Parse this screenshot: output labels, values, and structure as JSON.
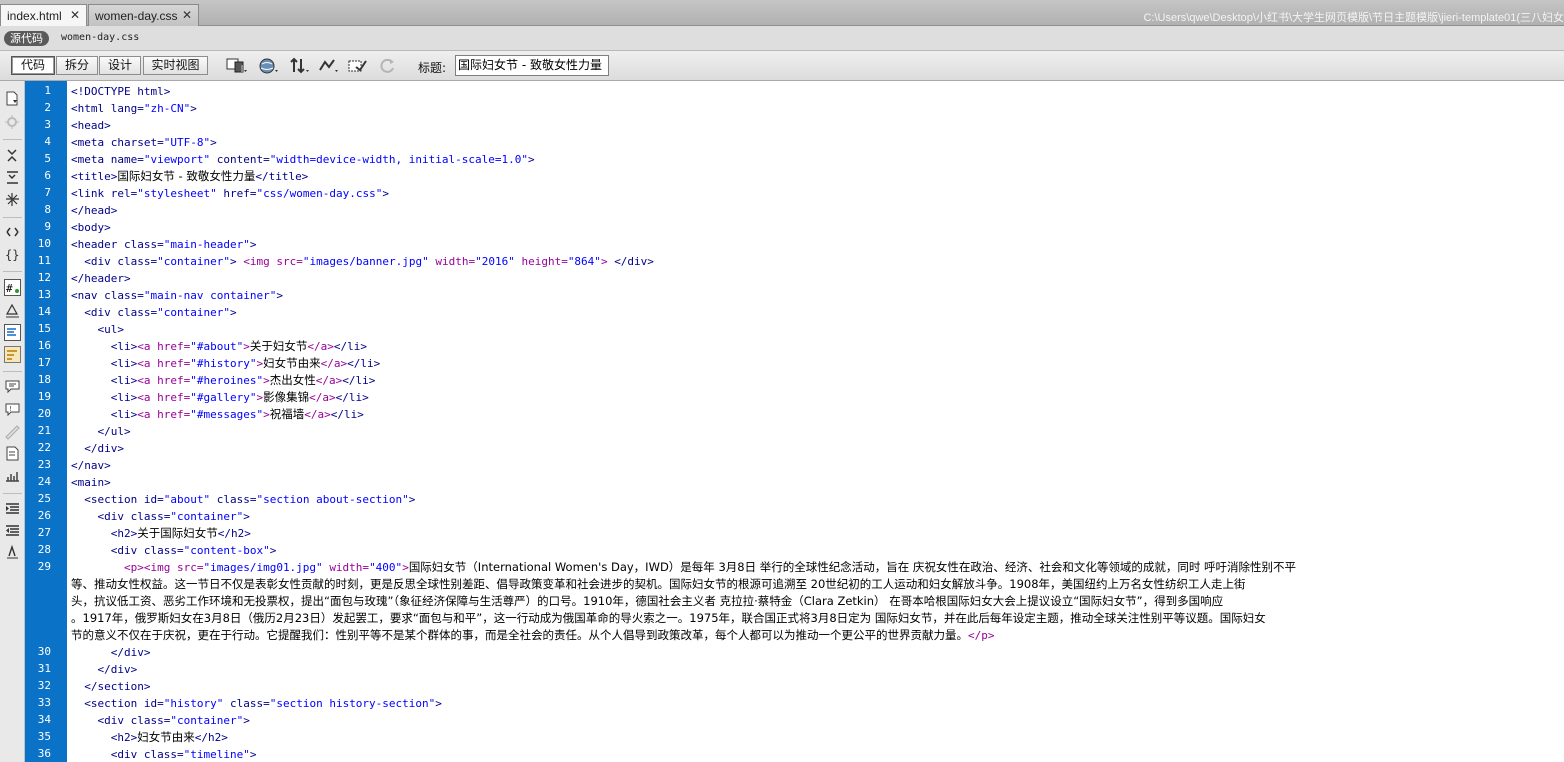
{
  "tabs": [
    {
      "label": "index.html",
      "active": true
    },
    {
      "label": "women-day.css",
      "active": false
    }
  ],
  "close_glyph": "✕",
  "file_path": "C:\\Users\\qwe\\Desktop\\小红书\\大学生网页模版\\节日主题模版\\jieri-template01(三八妇女",
  "related": {
    "source_code": "源代码",
    "file": "women-day.css"
  },
  "view_buttons": [
    "代码",
    "拆分",
    "设计",
    "实时视图"
  ],
  "title_label": "标题:",
  "title_value": "国际妇女节 - 致敬女性力量",
  "colors": {
    "gutter": "#0a72c7",
    "tag": "#000088",
    "value": "#0000ff",
    "inline_tag": "#990099"
  },
  "toolbar_icons": [
    "multiscreen-icon",
    "preview-globe-icon",
    "file-transfer-icon",
    "debug-icon",
    "visual-aids-icon",
    "refresh-icon"
  ],
  "sidebar_icons": [
    "open-documents-icon",
    "show-code-navigator-icon",
    "collapse-full-tag-icon",
    "collapse-selection-icon",
    "expand-all-icon",
    "select-parent-tag-icon",
    "balance-braces-icon",
    "line-numbers-icon",
    "highlight-invalid-code-icon",
    "syntax-coloring-icon",
    "word-wrap-icon",
    "info-bar-icon",
    "apply-comment-icon",
    "remove-comment-icon",
    "wrap-tag-icon",
    "recent-snippets-icon",
    "move-css-icon",
    "indent-code-icon",
    "outdent-code-icon",
    "format-source-icon"
  ],
  "code_lines": [
    {
      "n": "1",
      "html": "<span class='doctype'>&lt;!DOCTYPE html&gt;</span>"
    },
    {
      "n": "2",
      "html": "<span class='tag'>&lt;html</span> <span class='attr'>lang=</span><span class='val'>\"zh-CN\"</span><span class='tag'>&gt;</span>"
    },
    {
      "n": "3",
      "html": "<span class='tag'>&lt;head&gt;</span>"
    },
    {
      "n": "4",
      "html": "<span class='tag'>&lt;meta</span> <span class='attr'>charset=</span><span class='val'>\"UTF-8\"</span><span class='tag'>&gt;</span>"
    },
    {
      "n": "5",
      "html": "<span class='tag'>&lt;meta</span> <span class='attr'>name=</span><span class='val'>\"viewport\"</span> <span class='attr'>content=</span><span class='val'>\"width=device-width, initial-scale=1.0\"</span><span class='tag'>&gt;</span>"
    },
    {
      "n": "6",
      "html": "<span class='tag'>&lt;title&gt;</span><span class='txt'>国际妇女节 - 致敬女性力量</span><span class='tag'>&lt;/title&gt;</span>"
    },
    {
      "n": "7",
      "html": "<span class='tag'>&lt;link</span> <span class='attr'>rel=</span><span class='val'>\"stylesheet\"</span> <span class='attr'>href=</span><span class='val'>\"css/women-day.css\"</span><span class='tag'>&gt;</span>"
    },
    {
      "n": "8",
      "html": "<span class='tag'>&lt;/head&gt;</span>"
    },
    {
      "n": "9",
      "html": "<span class='tag'>&lt;body&gt;</span>"
    },
    {
      "n": "10",
      "html": "<span class='tag'>&lt;header</span> <span class='attr'>class=</span><span class='val'>\"main-header\"</span><span class='tag'>&gt;</span>"
    },
    {
      "n": "11",
      "html": "  <span class='tag'>&lt;div</span> <span class='attr'>class=</span><span class='val'>\"container\"</span><span class='tag'>&gt;</span> <span class='itag'>&lt;img</span> <span class='itag'>src=</span><span class='val'>\"images/banner.jpg\"</span> <span class='itag'>width=</span><span class='val'>\"2016\"</span> <span class='itag'>height=</span><span class='val'>\"864\"</span><span class='itag'>&gt;</span> <span class='tag'>&lt;/div&gt;</span>"
    },
    {
      "n": "12",
      "html": "<span class='tag'>&lt;/header&gt;</span>"
    },
    {
      "n": "13",
      "html": "<span class='tag'>&lt;nav</span> <span class='attr'>class=</span><span class='val'>\"main-nav container\"</span><span class='tag'>&gt;</span>"
    },
    {
      "n": "14",
      "html": "  <span class='tag'>&lt;div</span> <span class='attr'>class=</span><span class='val'>\"container\"</span><span class='tag'>&gt;</span>"
    },
    {
      "n": "15",
      "html": "    <span class='tag'>&lt;ul&gt;</span>"
    },
    {
      "n": "16",
      "html": "      <span class='tag'>&lt;li&gt;</span><span class='itag'>&lt;a</span> <span class='itag'>href=</span><span class='val'>\"#about\"</span><span class='itag'>&gt;</span><span class='txt'>关于妇女节</span><span class='itag'>&lt;/a&gt;</span><span class='tag'>&lt;/li&gt;</span>"
    },
    {
      "n": "17",
      "html": "      <span class='tag'>&lt;li&gt;</span><span class='itag'>&lt;a</span> <span class='itag'>href=</span><span class='val'>\"#history\"</span><span class='itag'>&gt;</span><span class='txt'>妇女节由来</span><span class='itag'>&lt;/a&gt;</span><span class='tag'>&lt;/li&gt;</span>"
    },
    {
      "n": "18",
      "html": "      <span class='tag'>&lt;li&gt;</span><span class='itag'>&lt;a</span> <span class='itag'>href=</span><span class='val'>\"#heroines\"</span><span class='itag'>&gt;</span><span class='txt'>杰出女性</span><span class='itag'>&lt;/a&gt;</span><span class='tag'>&lt;/li&gt;</span>"
    },
    {
      "n": "19",
      "html": "      <span class='tag'>&lt;li&gt;</span><span class='itag'>&lt;a</span> <span class='itag'>href=</span><span class='val'>\"#gallery\"</span><span class='itag'>&gt;</span><span class='txt'>影像集锦</span><span class='itag'>&lt;/a&gt;</span><span class='tag'>&lt;/li&gt;</span>"
    },
    {
      "n": "20",
      "html": "      <span class='tag'>&lt;li&gt;</span><span class='itag'>&lt;a</span> <span class='itag'>href=</span><span class='val'>\"#messages\"</span><span class='itag'>&gt;</span><span class='txt'>祝福墙</span><span class='itag'>&lt;/a&gt;</span><span class='tag'>&lt;/li&gt;</span>"
    },
    {
      "n": "21",
      "html": "    <span class='tag'>&lt;/ul&gt;</span>"
    },
    {
      "n": "22",
      "html": "  <span class='tag'>&lt;/div&gt;</span>"
    },
    {
      "n": "23",
      "html": "<span class='tag'>&lt;/nav&gt;</span>"
    },
    {
      "n": "24",
      "html": "<span class='tag'>&lt;main&gt;</span>"
    },
    {
      "n": "25",
      "html": "  <span class='tag'>&lt;section</span> <span class='attr'>id=</span><span class='val'>\"about\"</span> <span class='attr'>class=</span><span class='val'>\"section about-section\"</span><span class='tag'>&gt;</span>"
    },
    {
      "n": "26",
      "html": "    <span class='tag'>&lt;div</span> <span class='attr'>class=</span><span class='val'>\"container\"</span><span class='tag'>&gt;</span>"
    },
    {
      "n": "27",
      "html": "      <span class='tag'>&lt;h2&gt;</span><span class='txt'>关于国际妇女节</span><span class='tag'>&lt;/h2&gt;</span>"
    },
    {
      "n": "28",
      "html": "      <span class='tag'>&lt;div</span> <span class='attr'>class=</span><span class='val'>\"content-box\"</span><span class='tag'>&gt;</span>"
    },
    {
      "n": "29",
      "html": "        <span class='itag'>&lt;p&gt;&lt;img</span> <span class='itag'>src=</span><span class='val'>\"images/img01.jpg\"</span> <span class='itag'>width=</span><span class='val'>\"400\"</span><span class='itag'>&gt;</span><span class='txt'>国际妇女节（International Women's Day，IWD）是每年 3月8日 举行的全球性纪念活动，旨在 庆祝女性在政治、经济、社会和文化等领域的成就，同时 呼吁消除性别不平</span>"
    },
    {
      "n": "",
      "html": "<span class='txt'>等、推动女性权益。这一节日不仅是表彰女性贡献的时刻，更是反思全球性别差距、倡导政策变革和社会进步的契机。国际妇女节的根源可追溯至 20世纪初的工人运动和妇女解放斗争。1908年，美国纽约上万名女性纺织工人走上街</span>"
    },
    {
      "n": "",
      "html": "<span class='txt'>头，抗议低工资、恶劣工作环境和无投票权，提出“面包与玫瑰”（象征经济保障与生活尊严）的口号。1910年，德国社会主义者 克拉拉·蔡特金（Clara Zetkin） 在哥本哈根国际妇女大会上提议设立“国际妇女节”，得到多国响应</span>"
    },
    {
      "n": "",
      "html": "<span class='txt'>。1917年，俄罗斯妇女在3月8日（俄历2月23日）发起罢工，要求“面包与和平”，这一行动成为俄国革命的导火索之一。1975年，联合国正式将3月8日定为 国际妇女节，并在此后每年设定主题，推动全球关注性别平等议题。国际妇女</span>"
    },
    {
      "n": "",
      "html": "<span class='txt'>节的意义不仅在于庆祝，更在于行动。它提醒我们：性别平等不是某个群体的事，而是全社会的责任。从个人倡导到政策改革，每个人都可以为推动一个更公平的世界贡献力量。</span><span class='itag'>&lt;/p&gt;</span>"
    },
    {
      "n": "30",
      "html": "      <span class='tag'>&lt;/div&gt;</span>"
    },
    {
      "n": "31",
      "html": "    <span class='tag'>&lt;/div&gt;</span>"
    },
    {
      "n": "32",
      "html": "  <span class='tag'>&lt;/section&gt;</span>"
    },
    {
      "n": "33",
      "html": "  <span class='tag'>&lt;section</span> <span class='attr'>id=</span><span class='val'>\"history\"</span> <span class='attr'>class=</span><span class='val'>\"section history-section\"</span><span class='tag'>&gt;</span>"
    },
    {
      "n": "34",
      "html": "    <span class='tag'>&lt;div</span> <span class='attr'>class=</span><span class='val'>\"container\"</span><span class='tag'>&gt;</span>"
    },
    {
      "n": "35",
      "html": "      <span class='tag'>&lt;h2&gt;</span><span class='txt'>妇女节由来</span><span class='tag'>&lt;/h2&gt;</span>"
    },
    {
      "n": "36",
      "html": "      <span class='tag'>&lt;div</span> <span class='attr'>class=</span><span class='val'>\"timeline\"</span><span class='tag'>&gt;</span>"
    }
  ]
}
